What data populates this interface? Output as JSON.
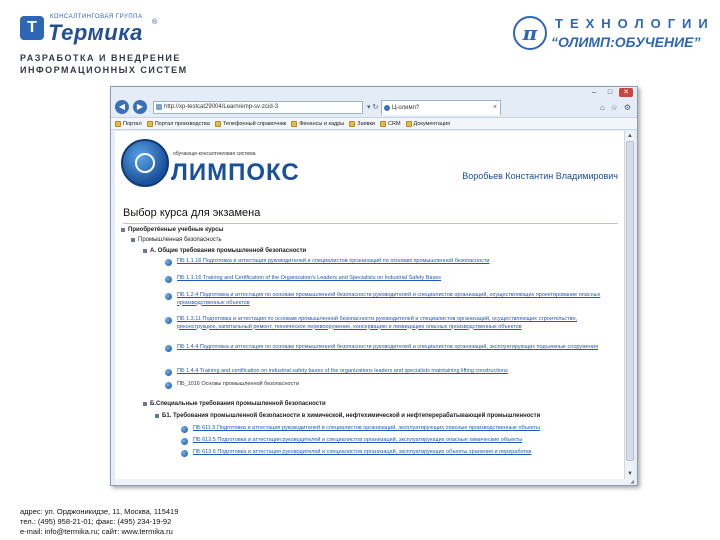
{
  "slide": {
    "company": {
      "group_label": "КОНСАЛТИНГОВАЯ ГРУППА",
      "name": "Термика",
      "registered_mark": "®",
      "mark_letter": "Т",
      "tagline": "РАЗРАБОТКА И ВНЕДРЕНИЕ ИНФОРМАЦИОННЫХ СИСТЕМ"
    },
    "partner": {
      "title": "ТЕХНОЛОГИИ",
      "subtitle": "“ОЛИМП:ОБУЧЕНИЕ”",
      "emblem_letter": "π"
    },
    "contacts": [
      "адрес: ул. Орджоникидзе, 11, Москва, 115419",
      "тел.: (495) 958-21-01; факс: (495) 234-19-92",
      "e-mail: info@termika.ru; сайт: www.termika.ru"
    ]
  },
  "browser": {
    "address": "http://xp-testcat29004/Learn/emp-sv-zcid-3",
    "tab_title": "Ц-олимп?",
    "window_buttons": [
      "–",
      "□",
      "✕"
    ],
    "nav": {
      "back": "◀",
      "forward": "▶",
      "tools": "▾ ↻ ✕"
    },
    "toolbar_icons": [
      "⌂",
      "☆",
      "⚙"
    ],
    "bookmarks": [
      "Портал",
      "Портал производства",
      "Телефонный справочник",
      "Финансы и кадры",
      "Заявки",
      "CRM",
      "Документация"
    ]
  },
  "page": {
    "lms_small": "обучающе-консалтинговая система",
    "lms_name": "ЛИМПОКС",
    "user": "Воробьев Константин Владимирович",
    "heading": "Выбор курса для экзамена",
    "tree": {
      "root": "Приобретённые учебные курсы",
      "level1": "Промышленная безопасность",
      "section_a": "А. Общие требования промышленной безопасности",
      "items": [
        {
          "text": "ПБ 1.1.16 Подготовка и аттестация руководителей и специалистов организаций по основам промышленной безопасности",
          "link": true
        },
        {
          "text": "ПБ 1.1.16 Training and Certification of the Organization's Leaders and Specialists on Industrial Safety Bases",
          "link": true
        },
        {
          "text": "ПБ 1.2.4 Подготовка и аттестация по основам промышленной безопасности руководителей и специалистов организаций, осуществляющих проектирование опасных производственных объектов",
          "link": true
        },
        {
          "text": "ПБ 1.3.11 Подготовка и аттестация по основам промышленной безопасности руководителей и специалистов организаций, осуществляющих строительство, реконструкцию, капитальный ремонт, техническое перевооружение, консервацию и ликвидацию опасных производственных объектов",
          "link": true
        },
        {
          "text": "ПБ 1.4.4 Подготовка и аттестация по основам промышленной безопасности руководителей и специалистов организаций, эксплуатирующих подъемные сооружения",
          "link": true
        },
        {
          "text": "ПБ 1.4.4 Training and certification on industrial safety bases of the organizations leaders and specialists maintaining lifting constructions",
          "link": true
        },
        {
          "text": "ПБ_1016 Основы промышленной безопасности",
          "link": false
        }
      ],
      "section_b": "Б.Специальные требования промышленной безопасности",
      "section_b1": "Б1. Требования промышленной безопасности в химической, нефтехимической и нефтеперерабатывающей промышленности",
      "sub_items": [
        {
          "text": "ПБ 611.5 Подготовка и аттестация руководителей и специалистов организаций, эксплуатирующих опасные производственные объекты"
        },
        {
          "text": "ПБ 612.5 Подготовка и аттестация руководителей и специалистов организаций, эксплуатирующих опасные химические объекты"
        },
        {
          "text": "ПБ 613.6 Подготовка и аттестация руководителей и специалистов организаций, эксплуатирующих объекты хранения и переработки"
        }
      ]
    }
  },
  "colors": {
    "brand_blue": "#2d67b3",
    "link": "#2257b5",
    "dark_blue": "#1a4f9a"
  }
}
